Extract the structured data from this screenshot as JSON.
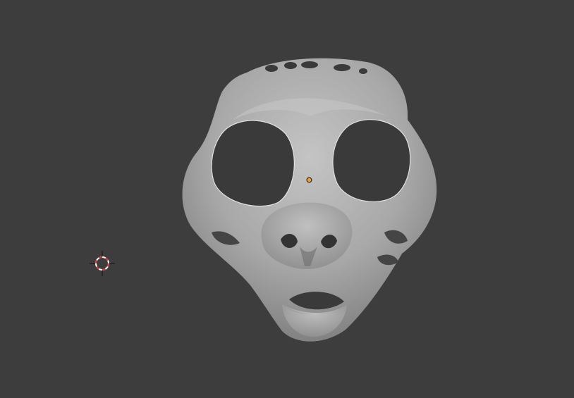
{
  "viewport": {
    "background": "#3d3d3d",
    "object": {
      "mesh_icon": "mask-mesh-icon",
      "surface_color": "#a9a9a9",
      "highlight_color": "#c9c9c9",
      "shadow_color": "#707070",
      "hole_color": "#3a3a3a"
    },
    "origin_color": "#f0a030",
    "cursor_colors": [
      "#d0352f",
      "#ffffff"
    ]
  }
}
